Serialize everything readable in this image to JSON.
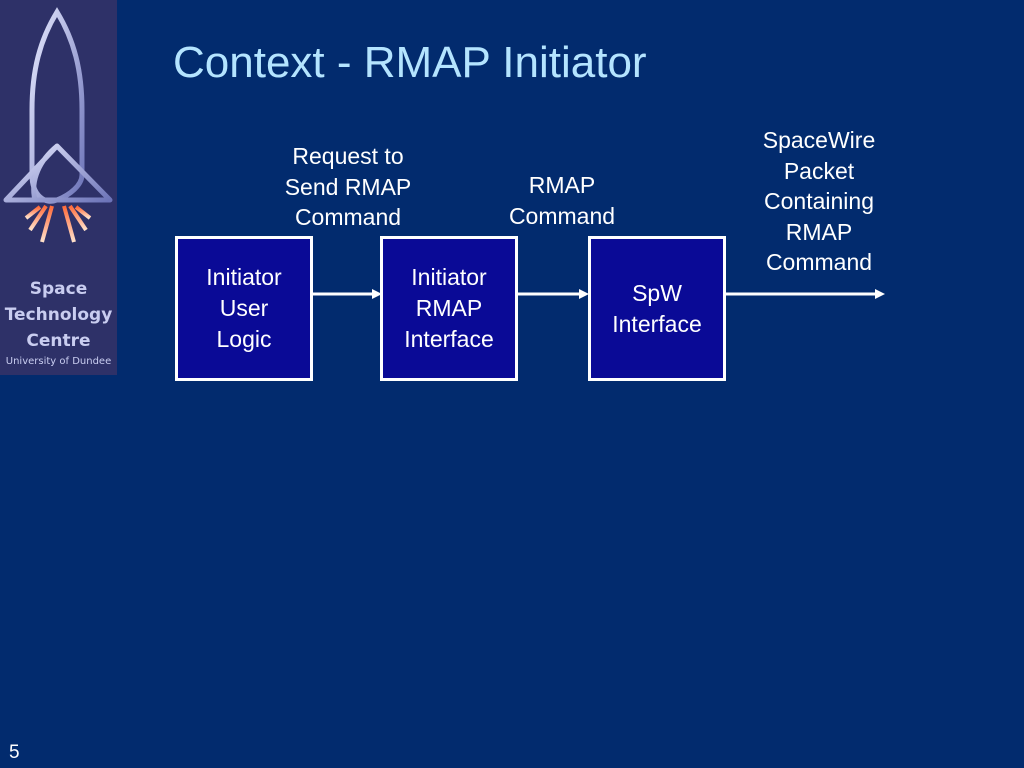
{
  "slide": {
    "title": "Context - RMAP Initiator",
    "page_number": "5"
  },
  "logo": {
    "line1": "Space",
    "line2": "Technology",
    "line3": "Centre",
    "line4": "University of Dundee"
  },
  "diagram": {
    "blocks": [
      {
        "id": "user-logic",
        "label": "Initiator\nUser\nLogic"
      },
      {
        "id": "rmap-interface",
        "label": "Initiator\nRMAP\nInterface"
      },
      {
        "id": "spw-interface",
        "label": "SpW\nInterface"
      }
    ],
    "connectors": [
      {
        "from": "user-logic",
        "to": "rmap-interface",
        "label": "Request to\nSend RMAP\nCommand"
      },
      {
        "from": "rmap-interface",
        "to": "spw-interface",
        "label": "RMAP\nCommand"
      },
      {
        "from": "spw-interface",
        "to": "output",
        "label": "SpaceWire\nPacket\nContaining\nRMAP\nCommand"
      }
    ]
  },
  "colors": {
    "background": "#022b6e",
    "title": "#b4e4ff",
    "block_fill": "#0a0a96",
    "logo_panel": "#2e3168"
  }
}
